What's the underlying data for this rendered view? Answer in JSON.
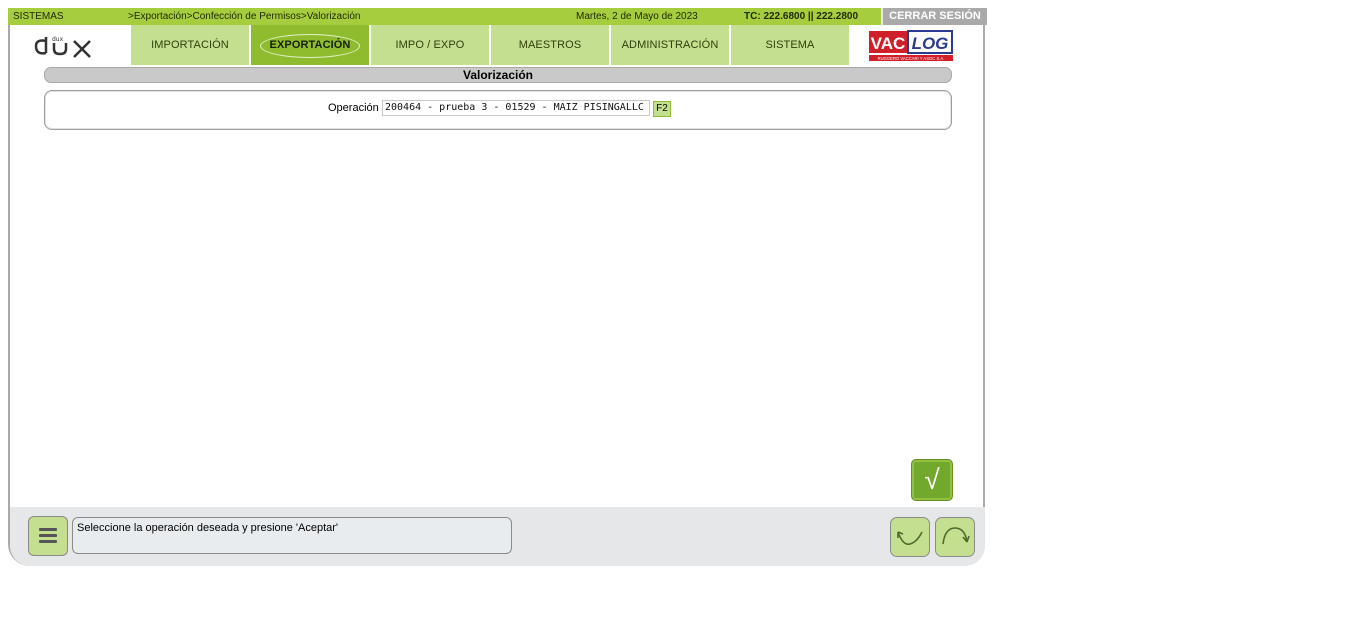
{
  "topbar": {
    "module": "SISTEMAS",
    "breadcrumb": ">Exportación>Confección de Permisos>Valorización",
    "date": "Martes, 2 de Mayo de 2023",
    "exchange_rate": "TC: 222.6800 || 222.2800",
    "logout_label": "CERRAR SESIÓN"
  },
  "nav": {
    "tabs": [
      {
        "label": "IMPORTACIÓN",
        "active": false
      },
      {
        "label": "EXPORTACIÓN",
        "active": true
      },
      {
        "label": "IMPO / EXPO",
        "active": false
      },
      {
        "label": "MAESTROS",
        "active": false
      },
      {
        "label": "ADMINISTRACIÓN",
        "active": false
      },
      {
        "label": "SISTEMA",
        "active": false
      }
    ]
  },
  "logos": {
    "left_text": "dux",
    "right_vac": "VAC",
    "right_log": "LOG",
    "right_subtitle": "RUGGERO VACCARI Y ASOC S.A."
  },
  "page": {
    "title": "Valorización",
    "operation_label": "Operación",
    "operation_value": "200464 - prueba 3 - 01529 - MAIZ PISINGALLC",
    "lookup_key": "F2",
    "accept_glyph": "√"
  },
  "status": {
    "message": "Seleccione la operación deseada y presione 'Aceptar'"
  },
  "colors": {
    "accent_green": "#a6cd3d",
    "tab_green": "#c5df90",
    "active_tab": "#8fbc2f",
    "logout_gray": "#a9a9a9"
  },
  "icons": [
    "menu-icon",
    "undo-arrow-icon",
    "redo-arrow-icon",
    "check-icon"
  ]
}
